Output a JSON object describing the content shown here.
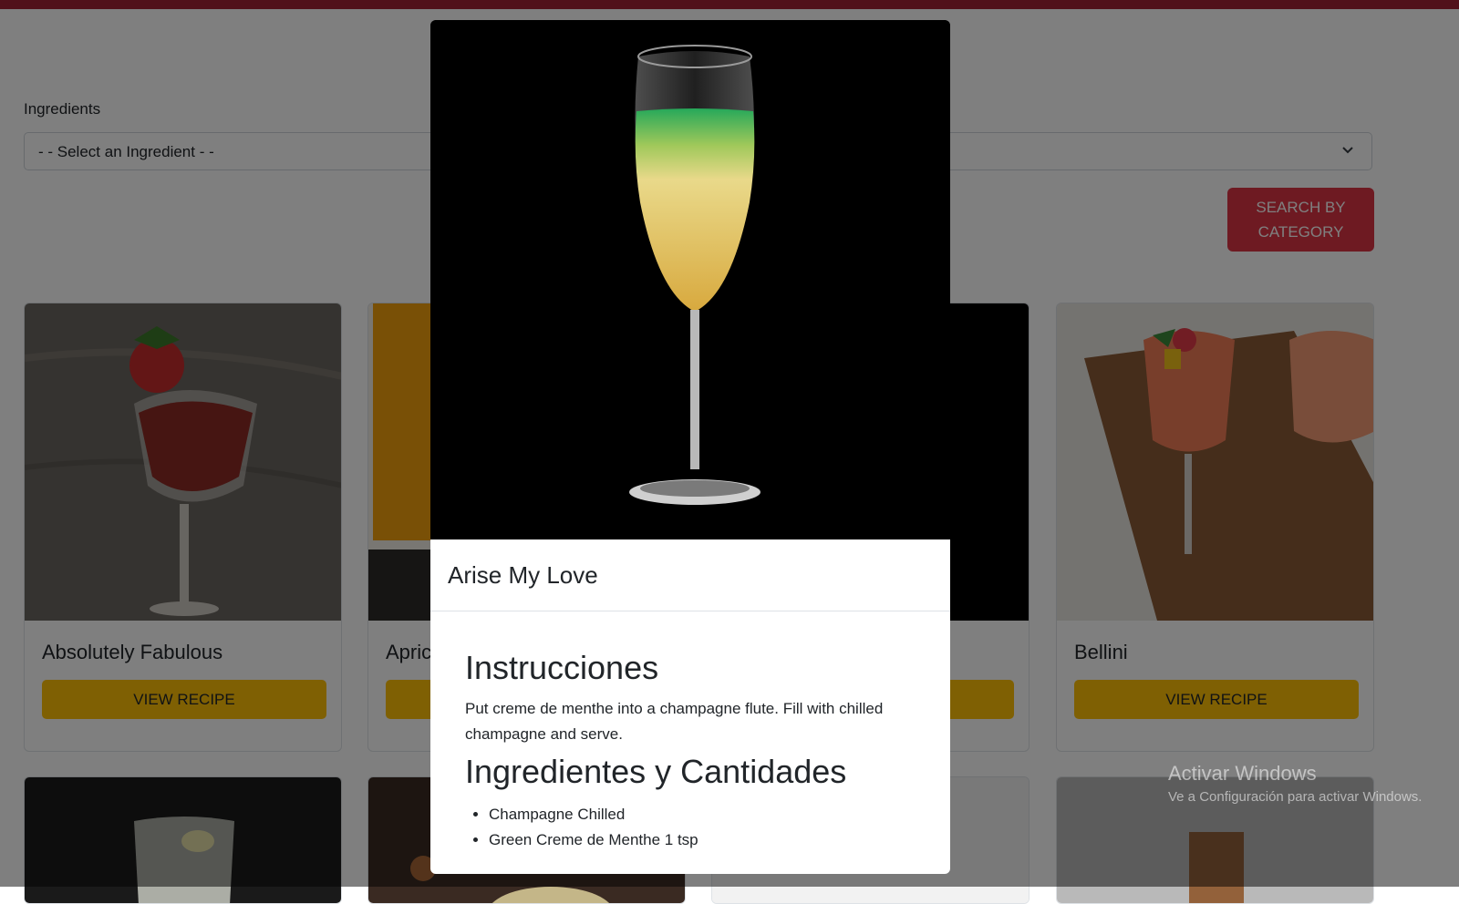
{
  "filters": {
    "ingredients_label": "Ingredients",
    "ingredient_select_value": "- - Select an Ingredient - -",
    "search_button_label": "SEARCH BY CATEGORY"
  },
  "cards": [
    {
      "title": "Absolutely Fabulous",
      "button": "VIEW RECIPE"
    },
    {
      "title": "Apric",
      "button": "VIEW RECIPE"
    },
    {
      "title": "",
      "button": "VIEW RECIPE"
    },
    {
      "title": "Bellini",
      "button": "VIEW RECIPE"
    }
  ],
  "modal": {
    "title": "Arise My Love",
    "instructions_heading": "Instrucciones",
    "instructions_text": "Put creme de menthe into a champagne flute. Fill with chilled champagne and serve.",
    "ingredients_heading": "Ingredientes y Cantidades",
    "ingredients": [
      "Champagne Chilled",
      "Green Creme de Menthe 1 tsp"
    ]
  },
  "watermark": {
    "title": "Activar Windows",
    "subtitle": "Ve a Configuración para activar Windows."
  },
  "colors": {
    "top_bar": "#a32234",
    "search_button": "#dc3545",
    "view_recipe_button": "#ffc107",
    "backdrop": "rgba(0,0,0,0.5)"
  }
}
